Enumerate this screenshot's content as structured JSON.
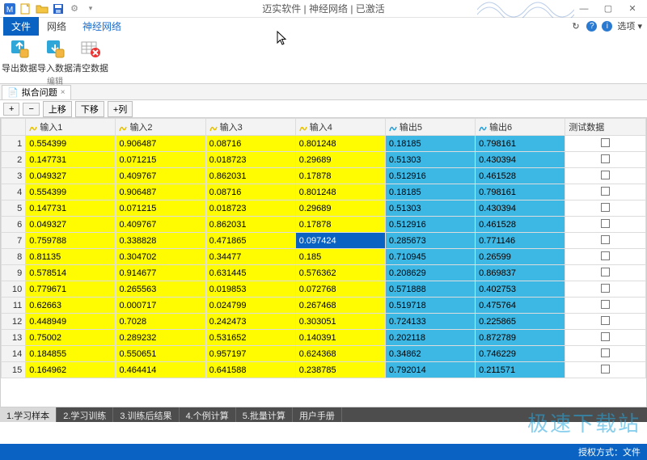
{
  "window": {
    "title": "迈实软件 | 神经网络 | 已激活"
  },
  "menu": {
    "tabs": [
      "文件",
      "网络",
      "神经网络"
    ],
    "options_label": "选项 ▾"
  },
  "ribbon": {
    "group_name": "编辑",
    "export": "导出数据",
    "import": "导入数据",
    "clear": "清空数据"
  },
  "doc": {
    "tab_label": "拟合问题"
  },
  "toolbar": {
    "add": "+",
    "remove": "−",
    "moveup": "上移",
    "movedown": "下移",
    "addcol": "+列"
  },
  "grid": {
    "headers": [
      "输入1",
      "输入2",
      "输入3",
      "输入4",
      "输出5",
      "输出6",
      "测试数据"
    ],
    "rows": [
      {
        "n": 1,
        "c": [
          "0.554399",
          "0.906487",
          "0.08716",
          "0.801248",
          "0.18185",
          "0.798161"
        ]
      },
      {
        "n": 2,
        "c": [
          "0.147731",
          "0.071215",
          "0.018723",
          "0.29689",
          "0.51303",
          "0.430394"
        ]
      },
      {
        "n": 3,
        "c": [
          "0.049327",
          "0.409767",
          "0.862031",
          "0.17878",
          "0.512916",
          "0.461528"
        ]
      },
      {
        "n": 4,
        "c": [
          "0.554399",
          "0.906487",
          "0.08716",
          "0.801248",
          "0.18185",
          "0.798161"
        ]
      },
      {
        "n": 5,
        "c": [
          "0.147731",
          "0.071215",
          "0.018723",
          "0.29689",
          "0.51303",
          "0.430394"
        ]
      },
      {
        "n": 6,
        "c": [
          "0.049327",
          "0.409767",
          "0.862031",
          "0.17878",
          "0.512916",
          "0.461528"
        ]
      },
      {
        "n": 7,
        "c": [
          "0.759788",
          "0.338828",
          "0.471865",
          "0.097424",
          "0.285673",
          "0.771146"
        ]
      },
      {
        "n": 8,
        "c": [
          "0.81135",
          "0.304702",
          "0.34477",
          "0.185",
          "0.710945",
          "0.26599"
        ]
      },
      {
        "n": 9,
        "c": [
          "0.578514",
          "0.914677",
          "0.631445",
          "0.576362",
          "0.208629",
          "0.869837"
        ]
      },
      {
        "n": 10,
        "c": [
          "0.779671",
          "0.265563",
          "0.019853",
          "0.072768",
          "0.571888",
          "0.402753"
        ]
      },
      {
        "n": 11,
        "c": [
          "0.62663",
          "0.000717",
          "0.024799",
          "0.267468",
          "0.519718",
          "0.475764"
        ]
      },
      {
        "n": 12,
        "c": [
          "0.448949",
          "0.7028",
          "0.242473",
          "0.303051",
          "0.724133",
          "0.225865"
        ]
      },
      {
        "n": 13,
        "c": [
          "0.75002",
          "0.289232",
          "0.531652",
          "0.140391",
          "0.202118",
          "0.872789"
        ]
      },
      {
        "n": 14,
        "c": [
          "0.184855",
          "0.550651",
          "0.957197",
          "0.624368",
          "0.34862",
          "0.746229"
        ]
      },
      {
        "n": 15,
        "c": [
          "0.164962",
          "0.464414",
          "0.641588",
          "0.238785",
          "0.792014",
          "0.211571"
        ]
      }
    ],
    "selected_row": 7,
    "selected_col": 3
  },
  "bottom_tabs": [
    "1.学习样本",
    "2.学习训练",
    "3.训练后结果",
    "4.个例计算",
    "5.批量计算",
    "用户手册"
  ],
  "active_bottom_tab": 0,
  "status": {
    "text": "授权方式：文件"
  },
  "watermark": "极速下载站"
}
